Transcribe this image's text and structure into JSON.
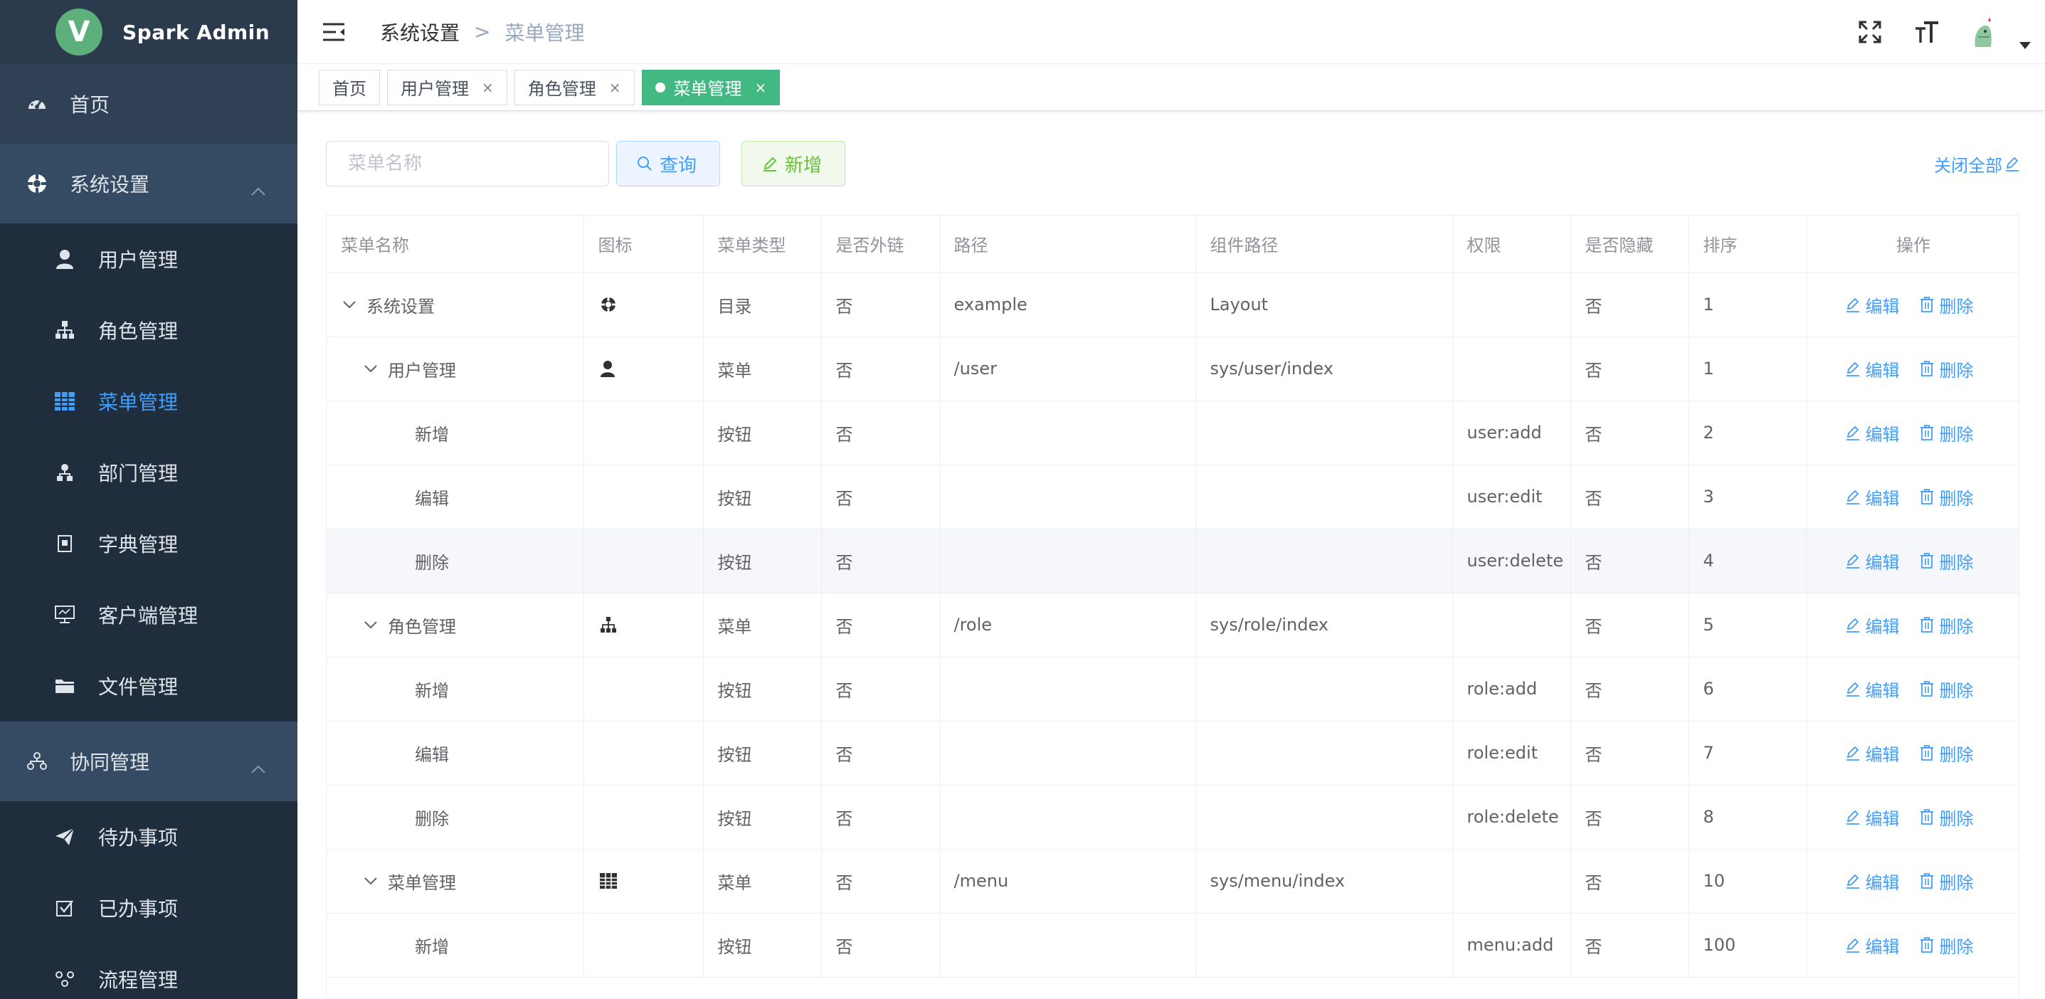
{
  "app": {
    "title": "Spark Admin",
    "logo_letter": "V"
  },
  "sidebar": {
    "home": {
      "label": "首页",
      "icon": "dashboard-icon"
    },
    "system": {
      "label": "系统设置",
      "icon": "settings-circle-icon",
      "items": [
        {
          "label": "用户管理",
          "icon": "user-icon"
        },
        {
          "label": "角色管理",
          "icon": "org-tree-icon"
        },
        {
          "label": "菜单管理",
          "icon": "table-grid-icon"
        },
        {
          "label": "部门管理",
          "icon": "department-icon"
        },
        {
          "label": "字典管理",
          "icon": "dictionary-icon"
        },
        {
          "label": "客户端管理",
          "icon": "monitor-icon"
        },
        {
          "label": "文件管理",
          "icon": "folder-icon"
        }
      ]
    },
    "collab": {
      "label": "协同管理",
      "icon": "workflow-icon",
      "items": [
        {
          "label": "待办事项",
          "icon": "send-icon"
        },
        {
          "label": "已办事项",
          "icon": "checkbox-icon"
        },
        {
          "label": "流程管理",
          "icon": "process-icon"
        }
      ]
    },
    "active_color": "#409eff"
  },
  "header": {
    "breadcrumb": [
      "系统设置",
      "菜单管理"
    ],
    "separator": ">"
  },
  "tags": [
    {
      "label": "首页",
      "closable": false,
      "active": false
    },
    {
      "label": "用户管理",
      "closable": true,
      "active": false
    },
    {
      "label": "角色管理",
      "closable": true,
      "active": false
    },
    {
      "label": "菜单管理",
      "closable": true,
      "active": true
    }
  ],
  "tag_close": "×",
  "toolbar": {
    "search_placeholder": "菜单名称",
    "query_label": "查询",
    "add_label": "新增",
    "close_all_label": "关闭全部"
  },
  "table": {
    "columns": [
      "菜单名称",
      "图标",
      "菜单类型",
      "是否外链",
      "路径",
      "组件路径",
      "权限",
      "是否隐藏",
      "排序",
      "操作"
    ],
    "edit_label": "编辑",
    "delete_label": "删除",
    "rows": [
      {
        "name": "系统设置",
        "icon": "settings-circle-icon",
        "type": "目录",
        "external": "否",
        "path": "example",
        "component": "Layout",
        "perm": "",
        "hidden": "否",
        "sort": "1"
      },
      {
        "name": "用户管理",
        "icon": "user-icon",
        "type": "菜单",
        "external": "否",
        "path": "/user",
        "component": "sys/user/index",
        "perm": "",
        "hidden": "否",
        "sort": "1"
      },
      {
        "name": "新增",
        "icon": "",
        "type": "按钮",
        "external": "否",
        "path": "",
        "component": "",
        "perm": "user:add",
        "hidden": "否",
        "sort": "2"
      },
      {
        "name": "编辑",
        "icon": "",
        "type": "按钮",
        "external": "否",
        "path": "",
        "component": "",
        "perm": "user:edit",
        "hidden": "否",
        "sort": "3"
      },
      {
        "name": "删除",
        "icon": "",
        "type": "按钮",
        "external": "否",
        "path": "",
        "component": "",
        "perm": "user:delete",
        "hidden": "否",
        "sort": "4"
      },
      {
        "name": "角色管理",
        "icon": "org-tree-icon",
        "type": "菜单",
        "external": "否",
        "path": "/role",
        "component": "sys/role/index",
        "perm": "",
        "hidden": "否",
        "sort": "5"
      },
      {
        "name": "新增",
        "icon": "",
        "type": "按钮",
        "external": "否",
        "path": "",
        "component": "",
        "perm": "role:add",
        "hidden": "否",
        "sort": "6"
      },
      {
        "name": "编辑",
        "icon": "",
        "type": "按钮",
        "external": "否",
        "path": "",
        "component": "",
        "perm": "role:edit",
        "hidden": "否",
        "sort": "7"
      },
      {
        "name": "删除",
        "icon": "",
        "type": "按钮",
        "external": "否",
        "path": "",
        "component": "",
        "perm": "role:delete",
        "hidden": "否",
        "sort": "8"
      },
      {
        "name": "菜单管理",
        "icon": "table-grid-icon",
        "type": "菜单",
        "external": "否",
        "path": "/menu",
        "component": "sys/menu/index",
        "perm": "",
        "hidden": "否",
        "sort": "10"
      },
      {
        "name": "新增",
        "icon": "",
        "type": "按钮",
        "external": "否",
        "path": "",
        "component": "",
        "perm": "menu:add",
        "hidden": "否",
        "sort": "100"
      }
    ]
  }
}
